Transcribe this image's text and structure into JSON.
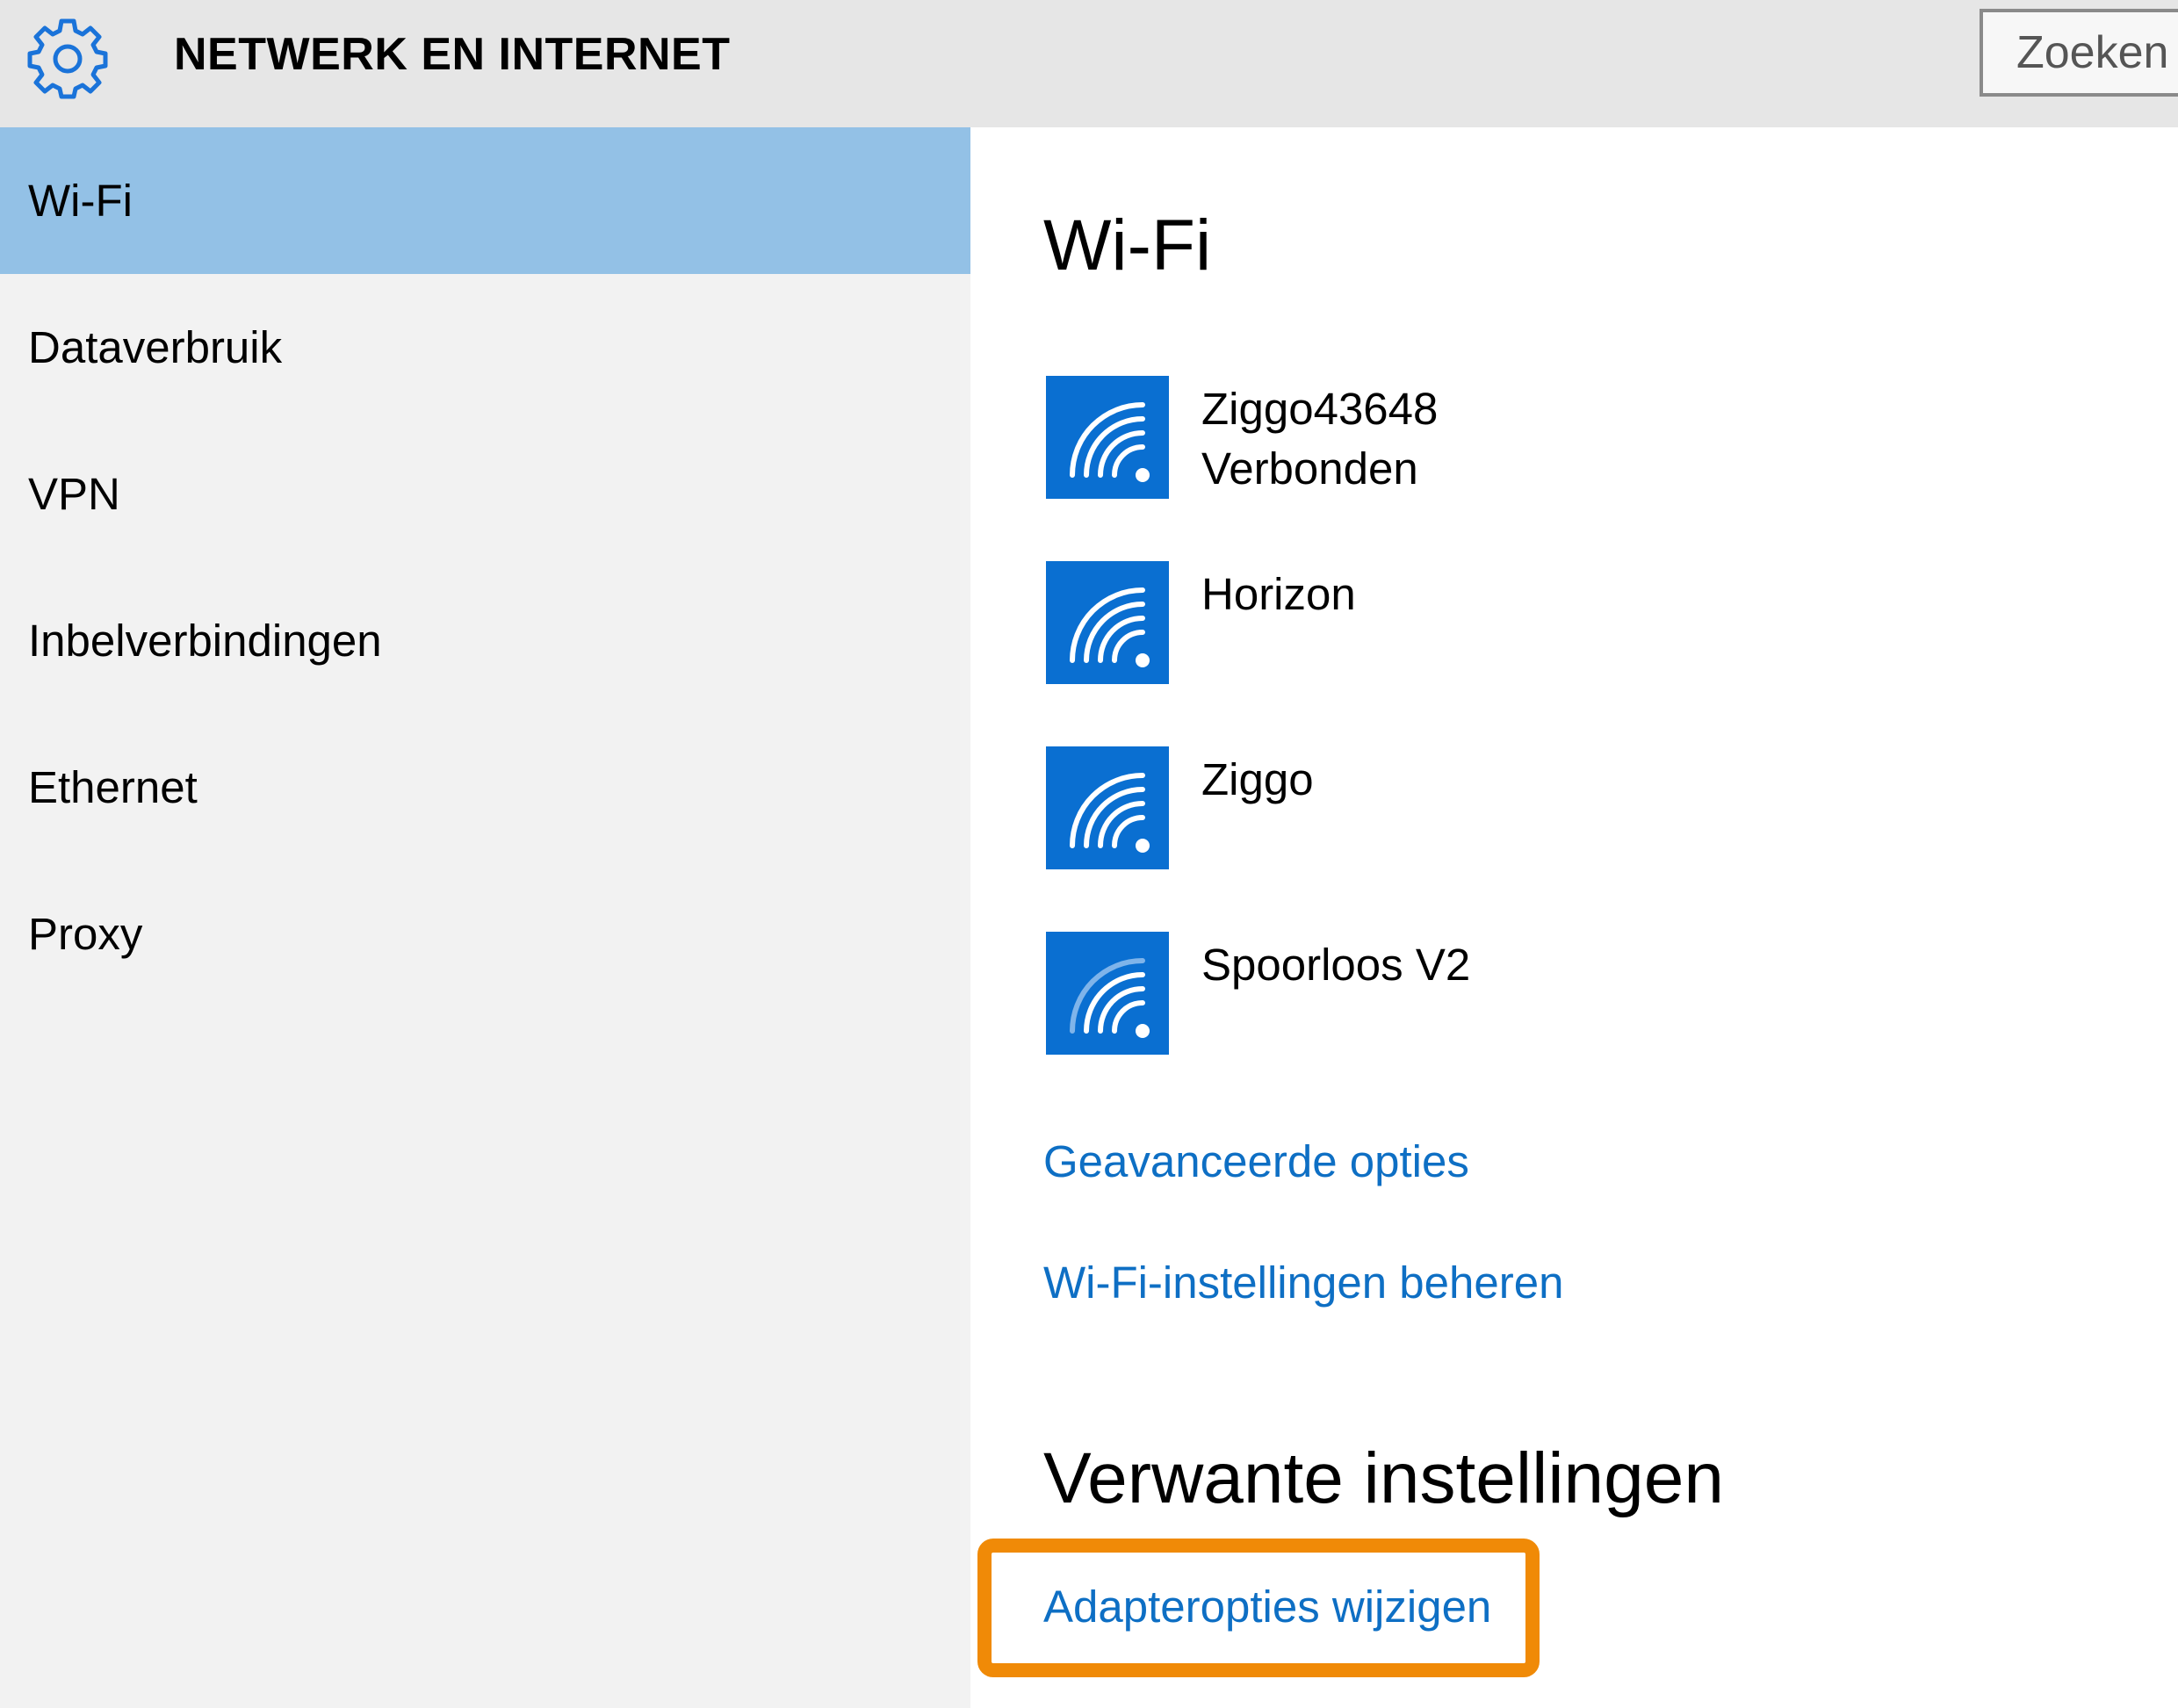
{
  "header": {
    "title": "NETWERK EN INTERNET",
    "search_placeholder": "Zoeken",
    "icon": "gear-icon"
  },
  "sidebar": {
    "items": [
      {
        "label": "Wi-Fi",
        "active": true
      },
      {
        "label": "Dataverbruik",
        "active": false
      },
      {
        "label": "VPN",
        "active": false
      },
      {
        "label": "Inbelverbindingen",
        "active": false
      },
      {
        "label": "Ethernet",
        "active": false
      },
      {
        "label": "Proxy",
        "active": false
      }
    ]
  },
  "main": {
    "title": "Wi-Fi",
    "networks": [
      {
        "name": "Ziggo43648",
        "status": "Verbonden",
        "icon": "wifi-signal-full-icon"
      },
      {
        "name": "Horizon",
        "status": "",
        "icon": "wifi-signal-full-icon"
      },
      {
        "name": "Ziggo",
        "status": "",
        "icon": "wifi-signal-full-icon"
      },
      {
        "name": "Spoorloos V2",
        "status": "",
        "icon": "wifi-signal-partial-icon"
      }
    ],
    "links": {
      "advanced": "Geavanceerde opties",
      "manage": "Wi-Fi-instellingen beheren"
    },
    "related": {
      "title": "Verwante instellingen",
      "adapter_link": "Adapteropties wijzigen"
    }
  },
  "colors": {
    "accent": "#0a6fd1",
    "link": "#0e6fc4",
    "selected": "#93c1e6",
    "highlight": "#f08a07"
  }
}
